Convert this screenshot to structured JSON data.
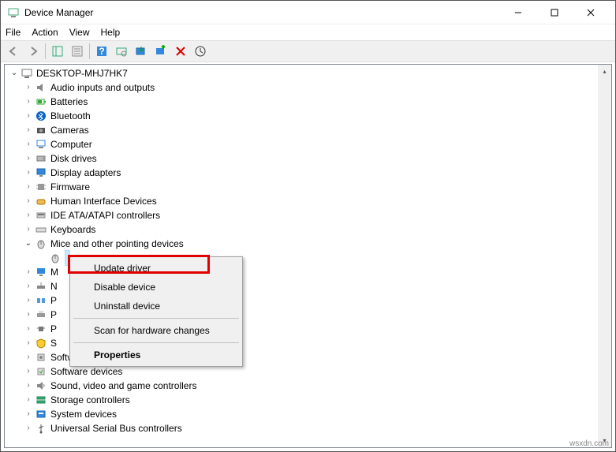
{
  "window": {
    "title": "Device Manager"
  },
  "menus": {
    "file": "File",
    "action": "Action",
    "view": "View",
    "help": "Help"
  },
  "root": {
    "name": "DESKTOP-MHJ7HK7"
  },
  "categories": [
    {
      "label": "Audio inputs and outputs",
      "icon": "audio"
    },
    {
      "label": "Batteries",
      "icon": "battery"
    },
    {
      "label": "Bluetooth",
      "icon": "bluetooth"
    },
    {
      "label": "Cameras",
      "icon": "camera"
    },
    {
      "label": "Computer",
      "icon": "computer"
    },
    {
      "label": "Disk drives",
      "icon": "disk"
    },
    {
      "label": "Display adapters",
      "icon": "display"
    },
    {
      "label": "Firmware",
      "icon": "firmware"
    },
    {
      "label": "Human Interface Devices",
      "icon": "hid"
    },
    {
      "label": "IDE ATA/ATAPI controllers",
      "icon": "ide"
    },
    {
      "label": "Keyboards",
      "icon": "keyboard"
    },
    {
      "label": "Mice and other pointing devices",
      "icon": "mouse",
      "expanded": true
    },
    {
      "label": "M",
      "icon": "monitor",
      "partial": true
    },
    {
      "label": "N",
      "icon": "network",
      "partial": true
    },
    {
      "label": "P",
      "icon": "port",
      "partial": true
    },
    {
      "label": "P",
      "icon": "printq",
      "partial": true
    },
    {
      "label": "P",
      "icon": "proc",
      "partial": true
    },
    {
      "label": "S",
      "icon": "security",
      "partial": true
    },
    {
      "label": "Software components",
      "icon": "swcomp"
    },
    {
      "label": "Software devices",
      "icon": "swdev"
    },
    {
      "label": "Sound, video and game controllers",
      "icon": "sound"
    },
    {
      "label": "Storage controllers",
      "icon": "storage"
    },
    {
      "label": "System devices",
      "icon": "system"
    },
    {
      "label": "Universal Serial Bus controllers",
      "icon": "usb"
    }
  ],
  "context_menu": {
    "update_driver": "Update driver",
    "disable_device": "Disable device",
    "uninstall_device": "Uninstall device",
    "scan": "Scan for hardware changes",
    "properties": "Properties"
  },
  "footer": "wsxdn.com"
}
